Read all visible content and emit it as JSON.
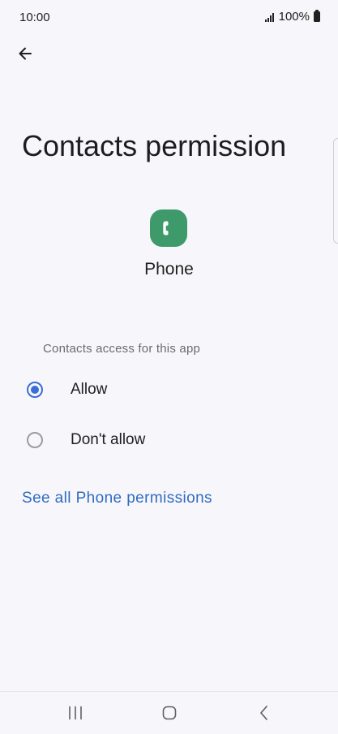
{
  "status_bar": {
    "time": "10:00",
    "battery": "100%"
  },
  "page": {
    "title": "Contacts permission"
  },
  "app": {
    "name": "Phone",
    "icon_color": "#3f9a6b"
  },
  "permission": {
    "section_label": "Contacts access for this app",
    "options": [
      {
        "label": "Allow",
        "selected": true
      },
      {
        "label": "Don't allow",
        "selected": false
      }
    ]
  },
  "links": {
    "see_all": "See all Phone permissions"
  },
  "colors": {
    "accent": "#3a6ed6",
    "link": "#2f6cc1",
    "background": "#f7f6fa"
  },
  "icons": {
    "back": "arrow-left",
    "app": "phone-handset",
    "nav_recents": "three-vertical-bars",
    "nav_home": "rounded-square",
    "nav_back": "chevron-left"
  }
}
